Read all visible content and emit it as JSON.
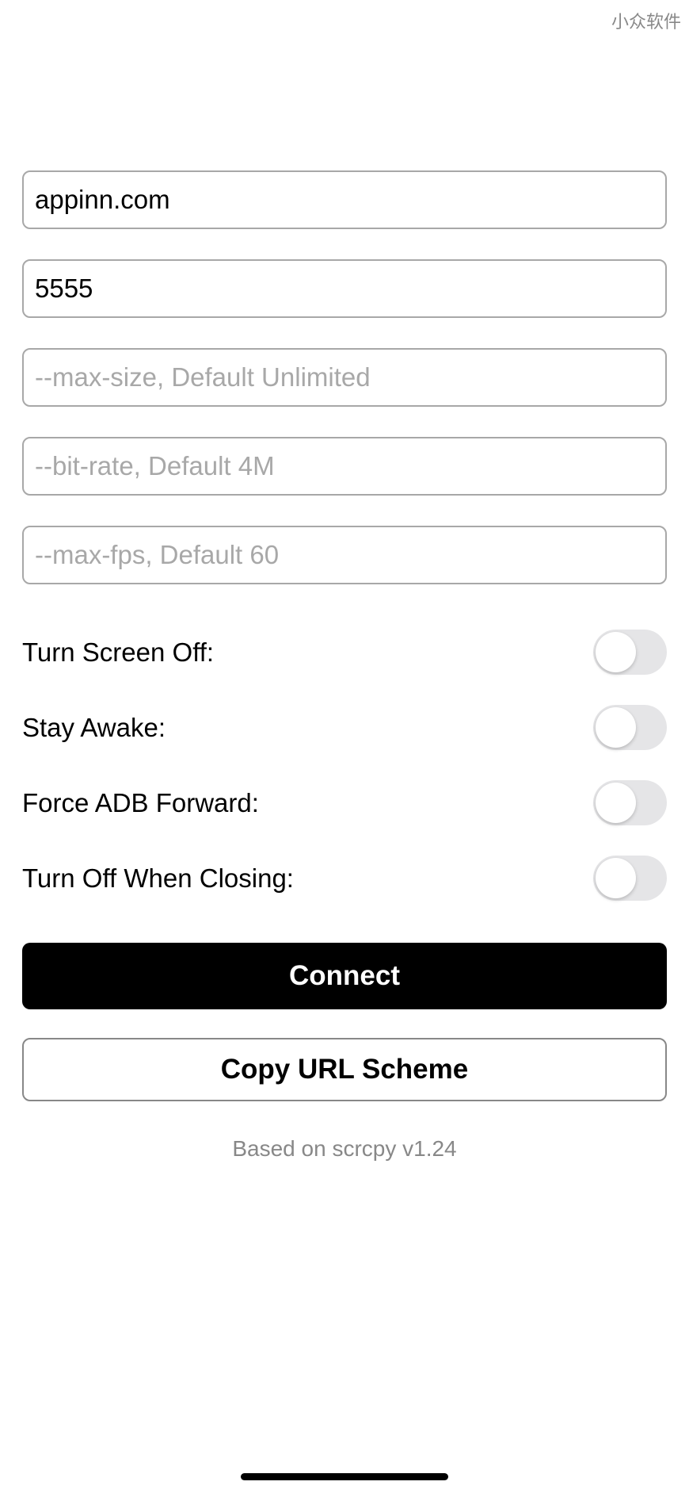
{
  "watermark": "小众软件",
  "inputs": {
    "host": {
      "value": "appinn.com",
      "placeholder": ""
    },
    "port": {
      "value": "5555",
      "placeholder": ""
    },
    "max_size": {
      "value": "",
      "placeholder": "--max-size, Default Unlimited"
    },
    "bit_rate": {
      "value": "",
      "placeholder": "--bit-rate, Default 4M"
    },
    "max_fps": {
      "value": "",
      "placeholder": "--max-fps, Default 60"
    }
  },
  "toggles": {
    "turn_screen_off": {
      "label": "Turn Screen Off:",
      "value": false
    },
    "stay_awake": {
      "label": "Stay Awake:",
      "value": false
    },
    "force_adb_forward": {
      "label": "Force ADB Forward:",
      "value": false
    },
    "turn_off_when_closing": {
      "label": "Turn Off When Closing:",
      "value": false
    }
  },
  "buttons": {
    "connect": "Connect",
    "copy_url_scheme": "Copy URL Scheme"
  },
  "footer": "Based on scrcpy v1.24"
}
